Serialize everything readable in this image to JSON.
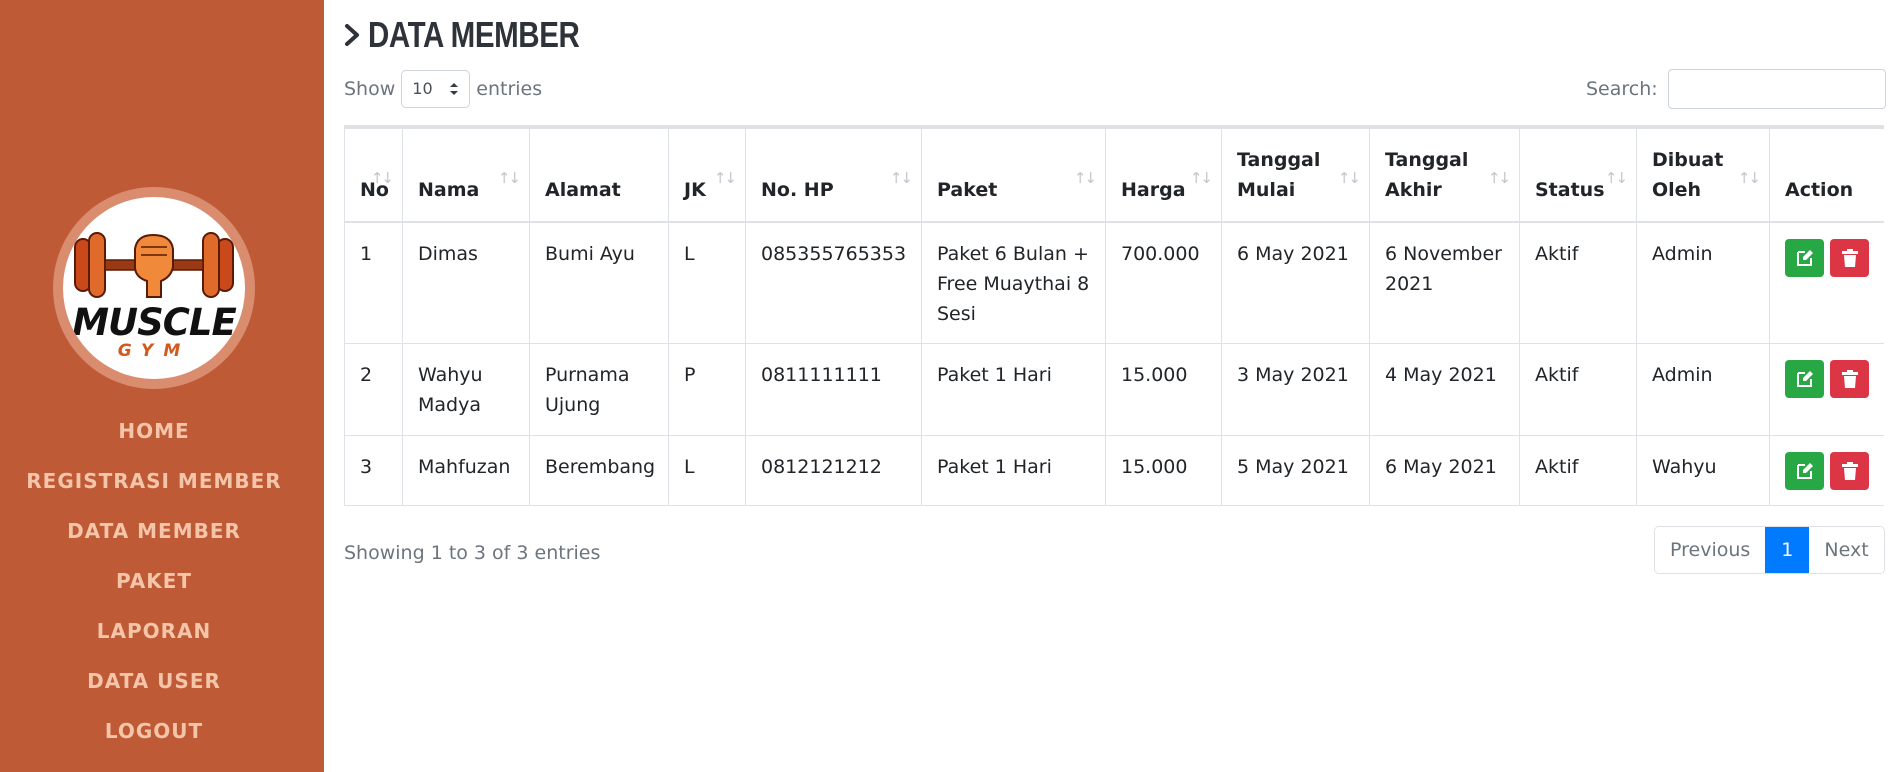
{
  "brand": {
    "name_top": "MUSCLE",
    "name_bottom": "GYM",
    "logo_colors": [
      "#d35a1d",
      "#111111"
    ]
  },
  "sidebar": {
    "bg": "#bf5a36",
    "items": [
      {
        "label": "HOME"
      },
      {
        "label": "REGISTRASI MEMBER"
      },
      {
        "label": "DATA MEMBER"
      },
      {
        "label": "PAKET"
      },
      {
        "label": "LAPORAN"
      },
      {
        "label": "DATA USER"
      },
      {
        "label": "LOGOUT"
      }
    ]
  },
  "page": {
    "title": "DATA MEMBER"
  },
  "controls": {
    "show_label": "Show",
    "entries_label": "entries",
    "length_value": "10",
    "search_label": "Search:"
  },
  "table": {
    "columns": [
      {
        "label": "No",
        "sortable": true
      },
      {
        "label": "Nama",
        "sortable": true
      },
      {
        "label": "Alamat",
        "sortable": false
      },
      {
        "label": "JK",
        "sortable": true
      },
      {
        "label": "No. HP",
        "sortable": true
      },
      {
        "label": "Paket",
        "sortable": true
      },
      {
        "label": "Harga",
        "sortable": true
      },
      {
        "label_1": "Tanggal",
        "label_2": "Mulai",
        "sortable": true
      },
      {
        "label_1": "Tanggal",
        "label_2": "Akhir",
        "sortable": true
      },
      {
        "label": "Status",
        "sortable": true
      },
      {
        "label_1": "Dibuat",
        "label_2": "Oleh",
        "sortable": true
      },
      {
        "label": "Action",
        "sortable": false
      }
    ],
    "rows": [
      {
        "no": "1",
        "nama": "Dimas",
        "alamat": "Bumi Ayu",
        "jk": "L",
        "hp": "085355765353",
        "paket": "Paket 6 Bulan + Free Muaythai 8 Sesi",
        "harga": "700.000",
        "mulai": "6 May 2021",
        "akhir": "6 November 2021",
        "status": "Aktif",
        "oleh": "Admin"
      },
      {
        "no": "2",
        "nama": "Wahyu Madya",
        "alamat": "Purnama Ujung",
        "jk": "P",
        "hp": "0811111111",
        "paket": "Paket 1 Hari",
        "harga": "15.000",
        "mulai": "3 May 2021",
        "akhir": "4 May 2021",
        "status": "Aktif",
        "oleh": "Admin"
      },
      {
        "no": "3",
        "nama": "Mahfuzan",
        "alamat": "Berembang",
        "jk": "L",
        "hp": "0812121212",
        "paket": "Paket 1 Hari",
        "harga": "15.000",
        "mulai": "5 May 2021",
        "akhir": "6 May 2021",
        "status": "Aktif",
        "oleh": "Wahyu"
      }
    ],
    "sort_glyph": "↑↓"
  },
  "footer": {
    "info": "Showing 1 to 3 of 3 entries",
    "prev": "Previous",
    "page": "1",
    "next": "Next"
  },
  "colors": {
    "edit": "#28a745",
    "delete": "#dc3545",
    "active_page": "#007bff"
  }
}
